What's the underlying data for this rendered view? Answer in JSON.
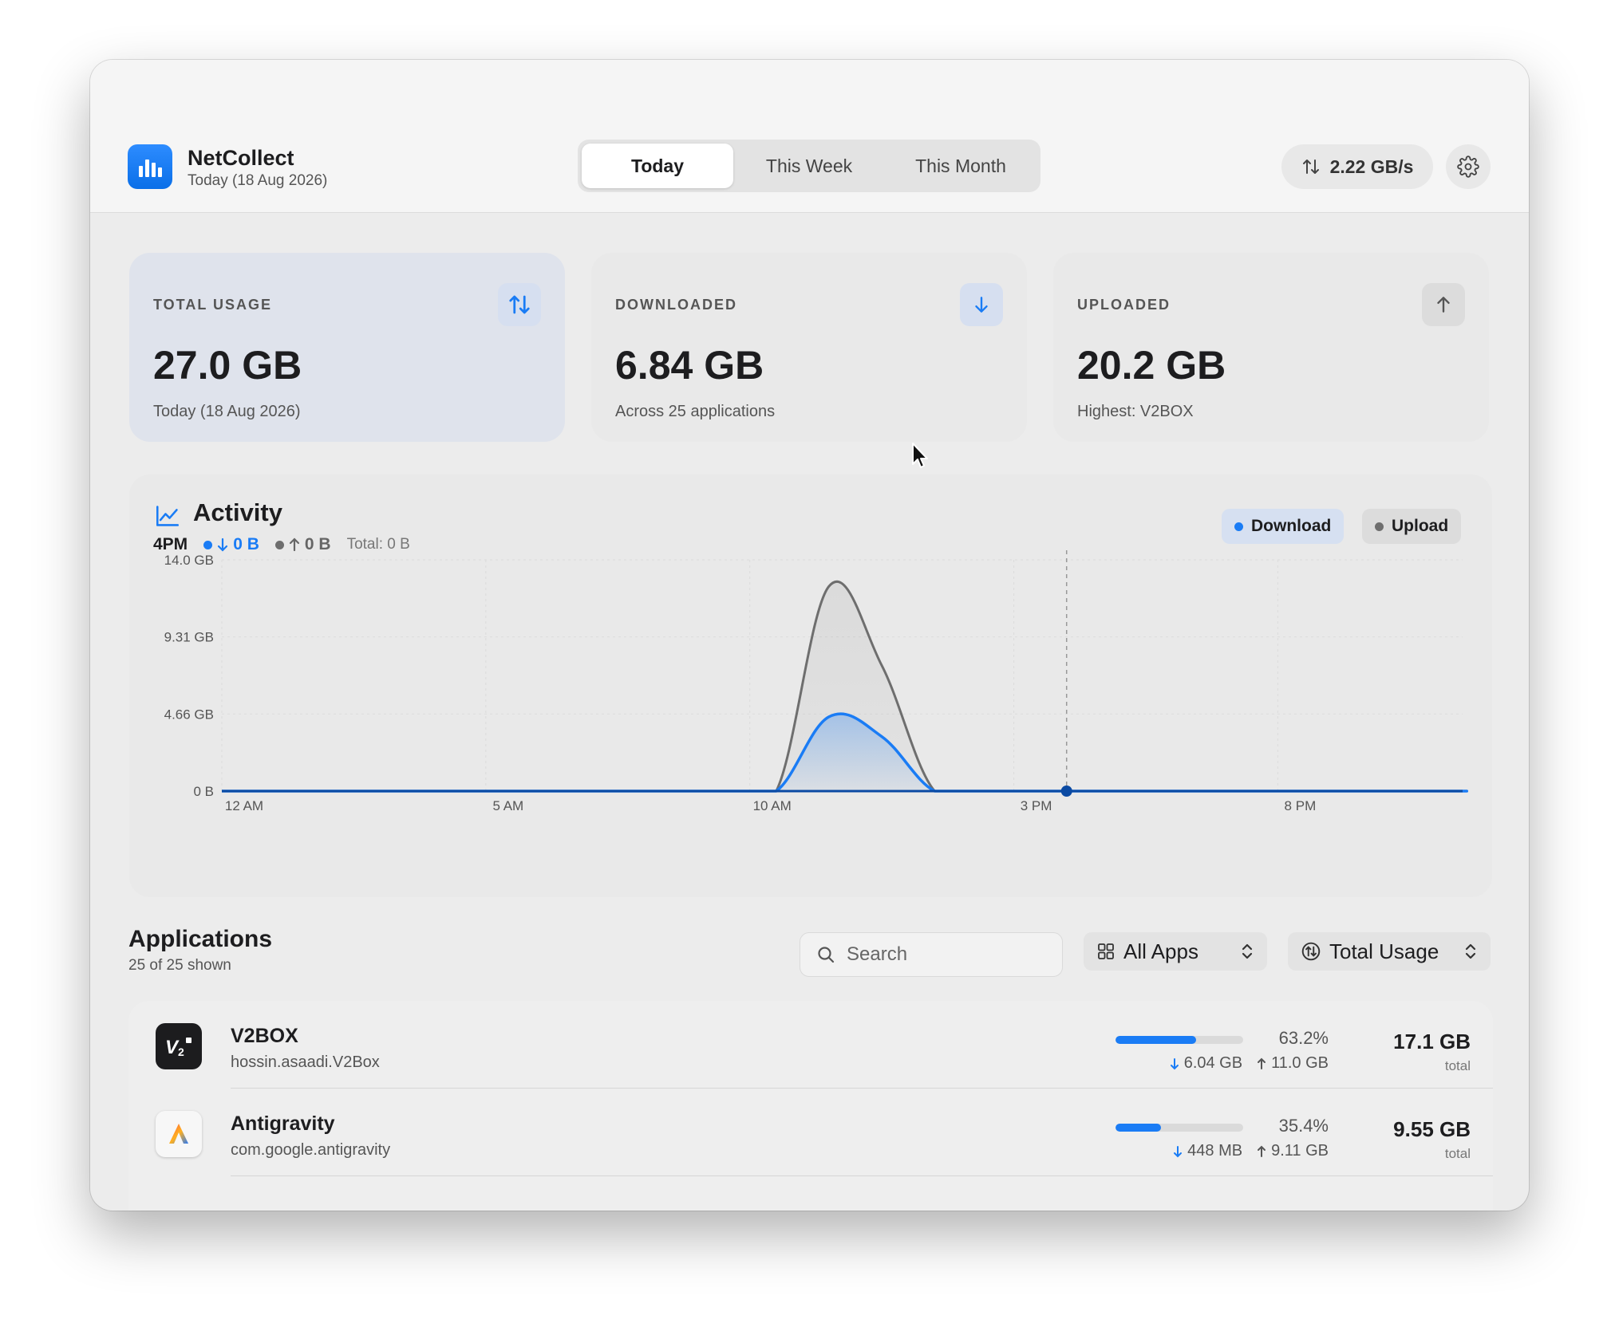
{
  "app": {
    "name": "NetCollect",
    "subtitle": "Today (18 Aug 2026)"
  },
  "tabs": [
    {
      "label": "Today",
      "active": true
    },
    {
      "label": "This Week",
      "active": false
    },
    {
      "label": "This Month",
      "active": false
    }
  ],
  "toolbar": {
    "speed": "2.22 GB/s",
    "speed_icon": "arrows-updown-icon",
    "settings_icon": "gear-icon"
  },
  "cards": [
    {
      "label": "TOTAL USAGE",
      "value": "27.0 GB",
      "sub": "Today (18 Aug 2026)",
      "icon": "arrows-updown-icon"
    },
    {
      "label": "DOWNLOADED",
      "value": "6.84 GB",
      "sub": "Across 25 applications",
      "icon": "arrow-down-icon"
    },
    {
      "label": "UPLOADED",
      "value": "20.2 GB",
      "sub": "Highest: V2BOX",
      "icon": "arrow-up-icon"
    }
  ],
  "activity": {
    "title": "Activity",
    "readout_time": "4PM",
    "readout_download": "0 B",
    "readout_upload": "0 B",
    "readout_total": "Total: 0 B",
    "legend_download": "Download",
    "legend_upload": "Upload"
  },
  "chart_data": {
    "type": "area",
    "x_ticks": [
      "12 AM",
      "5 AM",
      "10 AM",
      "3 PM",
      "8 PM"
    ],
    "y_ticks": [
      "14.0 GB",
      "9.31 GB",
      "4.66 GB",
      "0 B"
    ],
    "ylim": [
      0,
      14.0
    ],
    "y_unit": "GB",
    "x_hours": [
      0,
      1,
      2,
      3,
      4,
      5,
      6,
      7,
      8,
      9,
      10,
      11,
      12,
      13,
      14,
      15,
      16,
      17,
      18,
      19,
      20,
      21,
      22,
      23
    ],
    "series": [
      {
        "name": "Download",
        "color": "#1a7cf5",
        "values": [
          0,
          0,
          0,
          0,
          0,
          0,
          0,
          0,
          0,
          0,
          0,
          4.5,
          3.3,
          0,
          0,
          0,
          0,
          0,
          0,
          0,
          0,
          0,
          0,
          0
        ]
      },
      {
        "name": "Upload",
        "color": "#6e6e6e",
        "values": [
          0,
          0,
          0,
          0,
          0,
          0,
          0,
          0,
          0,
          0,
          0,
          12.4,
          7.6,
          0,
          0,
          0,
          0,
          0,
          0,
          0,
          0,
          0,
          0,
          0
        ]
      }
    ],
    "cursor_hour": 16,
    "grid": true,
    "legend": "top-right"
  },
  "applications": {
    "title": "Applications",
    "subtitle": "25 of 25 shown",
    "search_placeholder": "Search",
    "filter_label": "All Apps",
    "sort_label": "Total Usage",
    "rows": [
      {
        "name": "V2BOX",
        "bundle": "hossin.asaadi.V2Box",
        "percent": "63.2%",
        "percent_value": 63.2,
        "download": "6.04 GB",
        "upload": "11.0 GB",
        "total": "17.1 GB",
        "total_label": "total"
      },
      {
        "name": "Antigravity",
        "bundle": "com.google.antigravity",
        "percent": "35.4%",
        "percent_value": 35.4,
        "download": "448 MB",
        "upload": "9.11 GB",
        "total": "9.55 GB",
        "total_label": "total"
      }
    ]
  },
  "colors": {
    "accent": "#1a7cf5",
    "upload_gray": "#6e6e6e",
    "window_bg": "#ececec"
  }
}
